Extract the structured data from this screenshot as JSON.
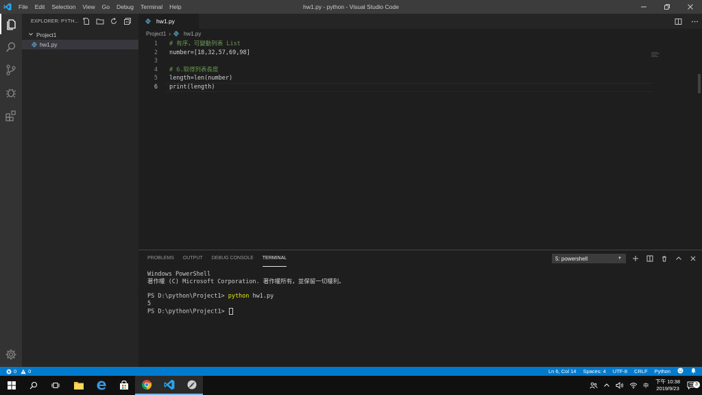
{
  "window": {
    "title": "hw1.py - python - Visual Studio Code",
    "menu": [
      "File",
      "Edit",
      "Selection",
      "View",
      "Go",
      "Debug",
      "Terminal",
      "Help"
    ]
  },
  "sidebar": {
    "title": "EXPLORER: PYTH...",
    "project": "Project1",
    "file": "hw1.py"
  },
  "editor": {
    "tab_label": "hw1.py",
    "breadcrumb": {
      "folder": "Project1",
      "file": "hw1.py"
    },
    "lines": [
      {
        "n": "1",
        "text": "# 有序，可變動列表 List"
      },
      {
        "n": "2",
        "text": "number=[18,32,57,69,98]"
      },
      {
        "n": "3",
        "text": ""
      },
      {
        "n": "4",
        "text": "# 6.取得列表長度"
      },
      {
        "n": "5",
        "text": "length=len(number)"
      },
      {
        "n": "6",
        "text": "print(length)"
      }
    ]
  },
  "panel": {
    "tabs": [
      "PROBLEMS",
      "OUTPUT",
      "DEBUG CONSOLE",
      "TERMINAL"
    ],
    "active_tab": "TERMINAL",
    "terminal_select": "5: powershell",
    "terminal": {
      "line1": "Windows PowerShell",
      "line2": "著作權 (C) Microsoft Corporation. 著作權所有，並保留一切權利。",
      "prompt1": "PS D:\\python\\Project1> ",
      "cmd": "python",
      "cmd_arg": " hw1.py",
      "output": "5",
      "prompt2": "PS D:\\python\\Project1> "
    }
  },
  "statusbar": {
    "errors": "0",
    "warnings": "0",
    "position": "Ln 6, Col 14",
    "spaces": "Spaces: 4",
    "encoding": "UTF-8",
    "eol": "CRLF",
    "language": "Python"
  },
  "taskbar": {
    "ime": "中",
    "time": "下午 10:38",
    "date": "2019/9/23",
    "notifications": "3"
  },
  "colors": {
    "accent": "#007acc",
    "python_icon": "#519aba",
    "comment": "#6a9955",
    "number": "#b5cea8",
    "function": "#dcdcaa",
    "terminal_cmd": "#e5e510"
  }
}
